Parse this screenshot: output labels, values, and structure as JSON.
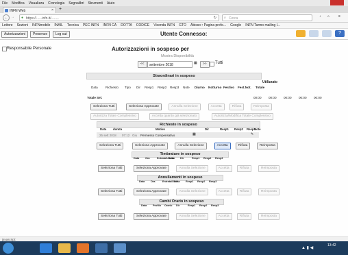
{
  "browser": {
    "menu": [
      "File",
      "Modifica",
      "Visualizza",
      "Cronologia",
      "Segnalibri",
      "Strumenti",
      "Aiuto"
    ],
    "tab_title": "INFN Web",
    "url": "https://......infn.it/........",
    "search_placeholder": "Cerca",
    "bookmarks": [
      "Lettore",
      "Sezioni",
      "INFNmobile",
      "INAIL",
      "Tecnica",
      "PEC INFN",
      "INFN CA",
      "DOTTA",
      "CODICE",
      "Vicenda INFN",
      "GTO",
      "Abisso • Pagina prefe...",
      "Google",
      "INFN Tarmo mailing l..."
    ]
  },
  "app_toolbar": {
    "btn_autorizzazioni": "Autorizzazioni",
    "btn_presenze": "Presenze",
    "btn_logout": "Log out",
    "user_label": "Utente Connesso:"
  },
  "page": {
    "left_label": "Responsabile Personale",
    "title": "Autorizzazioni in sospeso per",
    "subtitle": "Mostra Disponibilità",
    "nav_prev": "<<",
    "week_label": "settembre 2018",
    "nav_next": ">>",
    "tutti_label": "Tutti"
  },
  "straordinari": {
    "title": "Straordinari in sospeso",
    "utilizzato": "Utilizzato",
    "columns": [
      "Data",
      "Richiesto",
      "Tipo",
      "Dir",
      "Resp1",
      "Resp2",
      "Resp3",
      "Note",
      "Diurno",
      "Notturno",
      "Festivo",
      "Fest.Not.",
      "Totale"
    ],
    "totale_label": "Totale Sel.",
    "totale_values": [
      "00:00",
      "00:00",
      "00:00",
      "00:00",
      "00:00"
    ],
    "buttons": [
      "Seleziona Tutti",
      "Seleziona Approvate",
      "Annulla Selezione",
      "Accetta",
      "Rifiuta",
      "Reimposta"
    ],
    "buttons2": [
      "Autorizza Totale Complessivo",
      "Accetta quanto già selezionato",
      "Autorizza/Modifica Totale Complessivo"
    ]
  },
  "richieste": {
    "title": "Richieste in sospeso",
    "columns": [
      "Data",
      "durata",
      "Motivo",
      "Dir",
      "Resp1",
      "Resp2",
      "Resp3",
      "Note"
    ],
    "row": {
      "data": "25 sett 2018",
      "durata": "07:12",
      "tipo": "Giu",
      "motivo": "Permesso Compensativo"
    },
    "buttons": [
      "Seleziona Tutti",
      "Seleziona Approvate",
      "Annulla Selezione",
      "Accetta",
      "Rifiuta",
      "Reimposta"
    ]
  },
  "timbrature": {
    "title": "Timbrature in sospeso",
    "columns": [
      "Data",
      "Ora",
      "Entrata/Uscita",
      "Sede",
      "Dir",
      "Resp1",
      "Resp2",
      "Resp3"
    ],
    "buttons": [
      "Seleziona Tutti",
      "Seleziona Approvate",
      "Annulla Selezione",
      "Accetta",
      "Rifiuta",
      "Reimposta"
    ]
  },
  "annullamenti": {
    "title": "Annullamenti in sospeso",
    "columns": [
      "Data",
      "Ora",
      "Entrata/Uscita",
      "Dir",
      "Resp1",
      "Resp2",
      "Resp3"
    ],
    "buttons": [
      "Seleziona Tutti",
      "Seleziona Approvate",
      "Annulla Selezione",
      "Accetta",
      "Rifiuta",
      "Reimposta"
    ]
  },
  "cambi_orario": {
    "title": "Cambi Orario in sospeso",
    "columns": [
      "Data",
      "Profilo",
      "Orario",
      "Dir",
      "Resp1",
      "Resp2",
      "Resp3"
    ],
    "buttons": [
      "Seleziona Tutti",
      "Seleziona Approvate",
      "Annulla Selezione",
      "Accetta",
      "Rifiuta",
      "Reimposta"
    ]
  },
  "statusbar": {
    "text": "javascript:"
  },
  "taskbar": {
    "time": "13:42"
  },
  "colors": {
    "taskbar": "#1c3b5c",
    "highlight_row": "#e9e9e9",
    "accent_btn": "#3a6fc2"
  }
}
